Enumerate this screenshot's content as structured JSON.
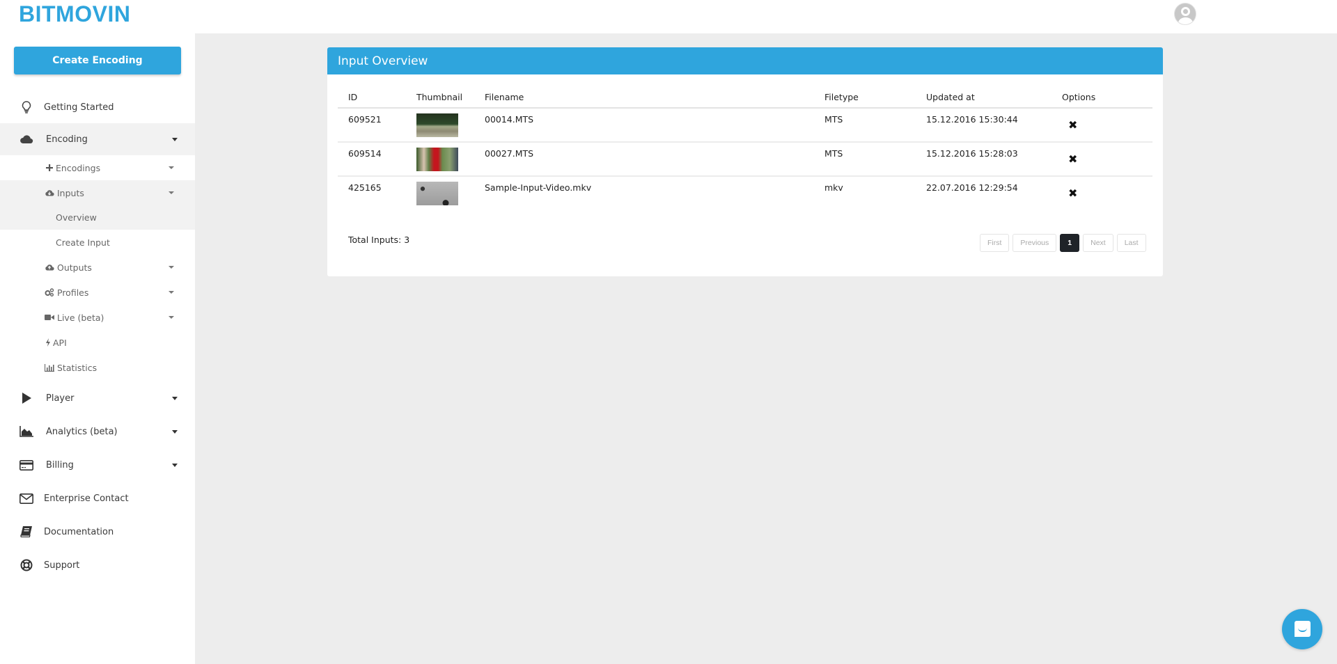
{
  "header": {
    "logo": "BITMOVIN",
    "avatar_icon": "user-avatar-icon"
  },
  "sidebar": {
    "create_button": "Create Encoding",
    "items": [
      {
        "label": "Getting Started",
        "icon": "lightbulb-icon",
        "expandable": false
      },
      {
        "label": "Encoding",
        "icon": "cloud-icon",
        "expandable": true,
        "expanded": true
      },
      {
        "label": "Player",
        "icon": "play-icon",
        "expandable": true
      },
      {
        "label": "Analytics (beta)",
        "icon": "area-chart-icon",
        "expandable": true
      },
      {
        "label": "Billing",
        "icon": "credit-card-icon",
        "expandable": true
      },
      {
        "label": "Enterprise Contact",
        "icon": "envelope-icon",
        "expandable": false
      },
      {
        "label": "Documentation",
        "icon": "book-icon",
        "expandable": false
      },
      {
        "label": "Support",
        "icon": "life-ring-icon",
        "expandable": false
      }
    ],
    "encoding_sub": [
      {
        "label": "Encodings",
        "icon": "plus-icon",
        "expandable": true
      },
      {
        "label": "Inputs",
        "icon": "cloud-download-icon",
        "expandable": true,
        "expanded": true
      },
      {
        "label": "Outputs",
        "icon": "cloud-upload-icon",
        "expandable": true
      },
      {
        "label": "Profiles",
        "icon": "cogs-icon",
        "expandable": true
      },
      {
        "label": "Live (beta)",
        "icon": "video-camera-icon",
        "expandable": true
      },
      {
        "label": "API",
        "icon": "bolt-icon",
        "expandable": false
      },
      {
        "label": "Statistics",
        "icon": "bar-chart-icon",
        "expandable": false
      }
    ],
    "inputs_sub": [
      {
        "label": "Overview",
        "active": true
      },
      {
        "label": "Create Input",
        "active": false
      }
    ]
  },
  "panel": {
    "title": "Input Overview",
    "columns": [
      "ID",
      "Thumbnail",
      "Filename",
      "Filetype",
      "Updated at",
      "Options"
    ],
    "rows": [
      {
        "id": "609521",
        "thumbnail": "field landscape",
        "filename": "00014.MTS",
        "filetype": "MTS",
        "updated_at": "15.12.2016 15:30:44",
        "option_icon": "delete-icon"
      },
      {
        "id": "609514",
        "thumbnail": "people outdoors",
        "filename": "00027.MTS",
        "filetype": "MTS",
        "updated_at": "15.12.2016 15:28:03",
        "option_icon": "delete-icon"
      },
      {
        "id": "425165",
        "thumbnail": "gray sample frame",
        "filename": "Sample-Input-Video.mkv",
        "filetype": "mkv",
        "updated_at": "22.07.2016 12:29:54",
        "option_icon": "delete-icon"
      }
    ],
    "total": "Total Inputs: 3",
    "pagination": {
      "first": "First",
      "previous": "Previous",
      "current": "1",
      "next": "Next",
      "last": "Last"
    }
  },
  "chat_widget": {
    "icon": "chat-icon"
  },
  "colors": {
    "brand": "#2fa5dd",
    "background": "#ededed",
    "active_page": "#1f2328"
  }
}
